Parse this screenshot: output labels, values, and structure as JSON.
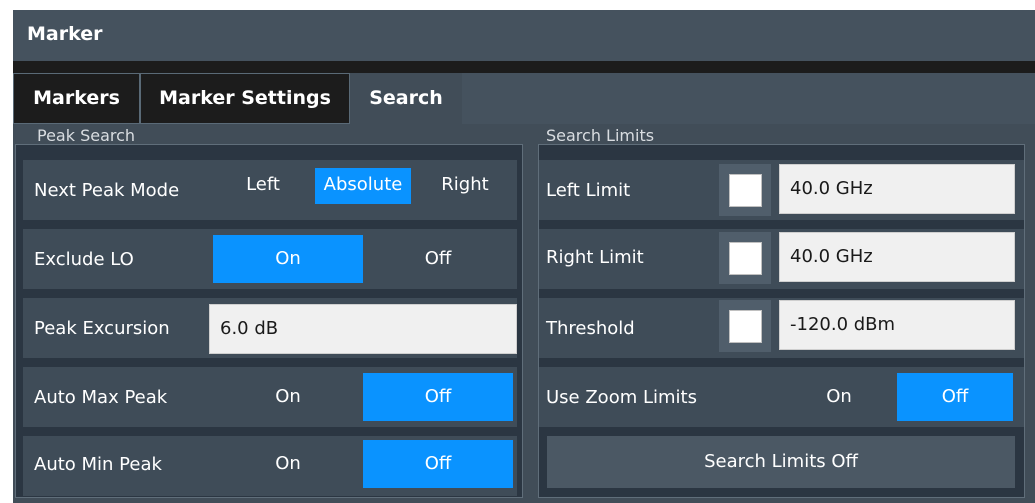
{
  "window": {
    "title": "Marker"
  },
  "tabs": [
    {
      "label": "Markers",
      "active": false
    },
    {
      "label": "Marker Settings",
      "active": false
    },
    {
      "label": "Search",
      "active": true
    }
  ],
  "peak_search": {
    "title": "Peak Search",
    "next_peak_mode": {
      "label": "Next Peak Mode",
      "options": [
        "Left",
        "Absolute",
        "Right"
      ],
      "selected": "Absolute"
    },
    "exclude_lo": {
      "label": "Exclude LO",
      "on_label": "On",
      "off_label": "Off",
      "selected": "On"
    },
    "peak_excursion": {
      "label": "Peak Excursion",
      "value": "6.0 dB"
    },
    "auto_max_peak": {
      "label": "Auto Max Peak",
      "on_label": "On",
      "off_label": "Off",
      "selected": "Off"
    },
    "auto_min_peak": {
      "label": "Auto Min Peak",
      "on_label": "On",
      "off_label": "Off",
      "selected": "Off"
    }
  },
  "search_limits": {
    "title": "Search Limits",
    "left_limit": {
      "label": "Left Limit",
      "value": "40.0 GHz",
      "checked": false
    },
    "right_limit": {
      "label": "Right Limit",
      "value": "40.0 GHz",
      "checked": false
    },
    "threshold": {
      "label": "Threshold",
      "value": "-120.0 dBm",
      "checked": false
    },
    "use_zoom_limits": {
      "label": "Use Zoom Limits",
      "on_label": "On",
      "off_label": "Off",
      "selected": "Off"
    },
    "off_button_label": "Search Limits Off"
  },
  "colors": {
    "accent": "#0a93ff",
    "title_bar": "#45525e",
    "panel": "#2b3642",
    "row": "#3f4c58"
  }
}
